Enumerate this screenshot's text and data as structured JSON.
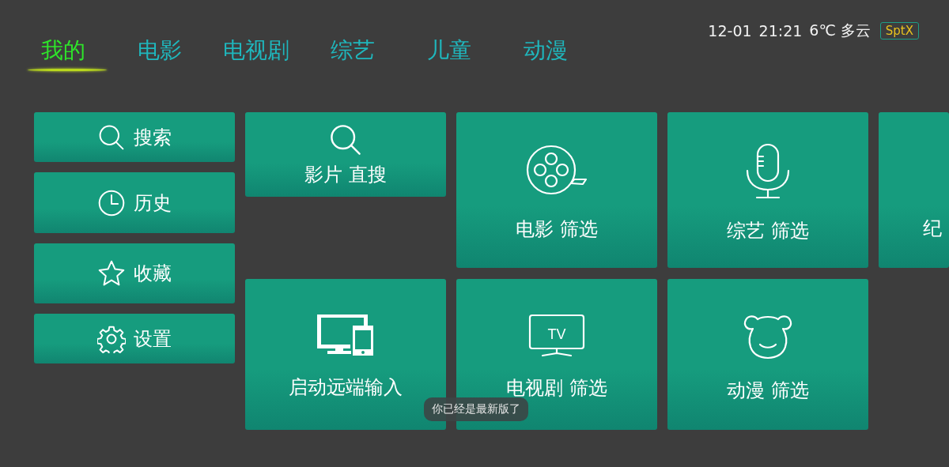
{
  "tabs": [
    {
      "label": "我的",
      "selected": true
    },
    {
      "label": "电影",
      "selected": false
    },
    {
      "label": "电视剧",
      "selected": false
    },
    {
      "label": "综艺",
      "selected": false
    },
    {
      "label": "儿童",
      "selected": false
    },
    {
      "label": "动漫",
      "selected": false
    }
  ],
  "status": {
    "date": "12-01",
    "time": "21:21",
    "weather": "6℃ 多云",
    "badge": "SptX"
  },
  "menu": [
    {
      "label": "搜索",
      "kind": "search"
    },
    {
      "label": "历史",
      "kind": "history"
    },
    {
      "label": "收藏",
      "kind": "favorites"
    },
    {
      "label": "设置",
      "kind": "settings"
    }
  ],
  "tiles": [
    {
      "label": "影片 直搜",
      "kind": "search"
    },
    {
      "label": "电影 筛选",
      "kind": "movies"
    },
    {
      "label": "综艺 筛选",
      "kind": "variety"
    },
    {
      "label": "纪",
      "kind": "partial"
    },
    {
      "label": "启动远端输入",
      "kind": "remote"
    },
    {
      "label": "电视剧 筛选",
      "kind": "series",
      "icon_text": "TV"
    },
    {
      "label": "动漫 筛选",
      "kind": "anime"
    }
  ],
  "toast": "你已经是最新版了"
}
